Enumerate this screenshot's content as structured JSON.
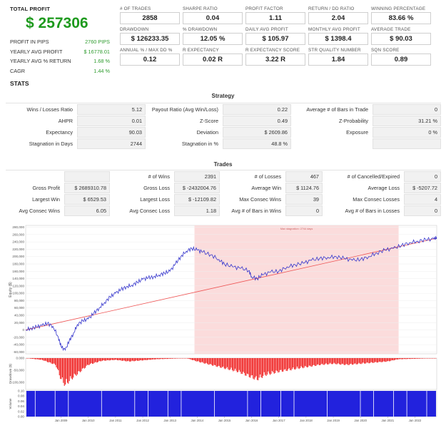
{
  "summary": {
    "total_profit_label": "TOTAL PROFIT",
    "total_profit_value": "$ 257306",
    "rows": [
      {
        "label": "PROFIT IN PIPS",
        "value": "2760 PIPS"
      },
      {
        "label": "YEARLY AVG PROFIT",
        "value": "$ 16778.01"
      },
      {
        "label": "YEARLY AVG % RETURN",
        "value": "1.68 %"
      },
      {
        "label": "CAGR",
        "value": "1.44 %"
      }
    ]
  },
  "stats_title": "STATS",
  "metrics": [
    {
      "label": "# OF TRADES",
      "value": "2858"
    },
    {
      "label": "SHARPE RATIO",
      "value": "0.04"
    },
    {
      "label": "PROFIT FACTOR",
      "value": "1.11"
    },
    {
      "label": "RETURN / DD RATIO",
      "value": "2.04"
    },
    {
      "label": "WINNING PERCENTAGE",
      "value": "83.66 %"
    },
    {
      "label": "DRAWDOWN",
      "value": "$ 126233.35"
    },
    {
      "label": "% DRAWDOWN",
      "value": "12.05 %"
    },
    {
      "label": "DAILY AVG PROFIT",
      "value": "$ 105.97"
    },
    {
      "label": "MONTHLY AVG PROFIT",
      "value": "$ 1398.4"
    },
    {
      "label": "AVERAGE TRADE",
      "value": "$ 90.03"
    },
    {
      "label": "ANNUAL % / MAX DD %",
      "value": "0.12"
    },
    {
      "label": "R EXPECTANCY",
      "value": "0.02 R"
    },
    {
      "label": "R EXPECTANCY SCORE",
      "value": "3.22 R"
    },
    {
      "label": "STR QUALITY NUMBER",
      "value": "1.84"
    },
    {
      "label": "SQN SCORE",
      "value": "0.89"
    }
  ],
  "strategy": {
    "title": "Strategy",
    "rows": [
      [
        {
          "label": "Wins / Losses Ratio",
          "value": "5.12"
        },
        {
          "label": "Payout Ratio (Avg Win/Loss)",
          "value": "0.22"
        },
        {
          "label": "Average # of Bars in Trade",
          "value": "0"
        }
      ],
      [
        {
          "label": "AHPR",
          "value": "0.01"
        },
        {
          "label": "Z-Score",
          "value": "0.49"
        },
        {
          "label": "Z-Probability",
          "value": "31.21 %"
        }
      ],
      [
        {
          "label": "Expectancy",
          "value": "90.03"
        },
        {
          "label": "Deviation",
          "value": "$ 2609.86"
        },
        {
          "label": "Exposure",
          "value": "0 %"
        }
      ],
      [
        {
          "label": "Stagnation in Days",
          "value": "2744"
        },
        {
          "label": "Stagnation in %",
          "value": "48.8 %"
        },
        {
          "label": "",
          "value": ""
        }
      ]
    ]
  },
  "trades": {
    "title": "Trades",
    "rows": [
      [
        {
          "label": "",
          "value": ""
        },
        {
          "label": "# of Wins",
          "value": "2391"
        },
        {
          "label": "# of Losses",
          "value": "467"
        },
        {
          "label": "# of Cancelled/Expired",
          "value": "0"
        }
      ],
      [
        {
          "label": "Gross Profit",
          "value": "$ 2689310.78"
        },
        {
          "label": "Gross Loss",
          "value": "$ -2432004.76"
        },
        {
          "label": "Average Win",
          "value": "$ 1124.76"
        },
        {
          "label": "Average Loss",
          "value": "$ -5207.72"
        }
      ],
      [
        {
          "label": "Largest Win",
          "value": "$ 6529.53"
        },
        {
          "label": "Largest Loss",
          "value": "$ -12109.82"
        },
        {
          "label": "Max Consec Wins",
          "value": "39"
        },
        {
          "label": "Max Consec Losses",
          "value": "4"
        }
      ],
      [
        {
          "label": "Avg Consec Wins",
          "value": "6.05"
        },
        {
          "label": "Avg Consec Loss",
          "value": "1.18"
        },
        {
          "label": "Avg # of Bars in Wins",
          "value": "0"
        },
        {
          "label": "Avg # of Bars in Losses",
          "value": "0"
        }
      ]
    ]
  },
  "chart_data": {
    "type": "line",
    "panels": [
      "equity",
      "drawdown",
      "volume"
    ],
    "stagnation_label": "Max stagnation: 2744 days",
    "equity_axis": {
      "label": "Equity ($)",
      "ticks": [
        "280,000",
        "260,000",
        "240,000",
        "220,000",
        "200,000",
        "180,000",
        "160,000",
        "140,000",
        "120,000",
        "100,000",
        "80,000",
        "60,000",
        "40,000",
        "20,000",
        "0",
        "-20,000",
        "-40,000",
        "-60,000"
      ],
      "ylim": [
        -65000,
        285000
      ]
    },
    "drawdown_axis": {
      "label": "Drawdown ($)",
      "ticks": [
        "0.000",
        "-50,000",
        "-100,000"
      ],
      "ylim": [
        -130000,
        0
      ]
    },
    "volume_axis": {
      "label": "Volume",
      "ticks": [
        "0.10",
        "0.08",
        "0.06",
        "0.04",
        "0.02",
        "0.00"
      ],
      "ylim": [
        0,
        0.1
      ]
    },
    "x_ticks": [
      "Jan 2009",
      "Jan 2010",
      "Jan 2011",
      "Jan 2012",
      "Jan 2013",
      "Jan 2014",
      "Jan 2015",
      "Jan 2016",
      "Jan 2017",
      "Jan 2018",
      "Jan 2019",
      "Jan 2020",
      "Jan 2021",
      "Jan 2022"
    ],
    "xlim": [
      2007.7,
      2022.8
    ],
    "stagnation_period": [
      2013.9,
      2021.4
    ],
    "trend_line": [
      [
        2007.7,
        0
      ],
      [
        2022.8,
        250000
      ]
    ],
    "equity_series": [
      [
        2007.7,
        0
      ],
      [
        2007.9,
        5000
      ],
      [
        2008.1,
        8000
      ],
      [
        2008.3,
        12000
      ],
      [
        2008.5,
        18000
      ],
      [
        2008.7,
        10000
      ],
      [
        2008.9,
        -20000
      ],
      [
        2009.0,
        -45000
      ],
      [
        2009.15,
        -55000
      ],
      [
        2009.3,
        -30000
      ],
      [
        2009.45,
        -10000
      ],
      [
        2009.6,
        15000
      ],
      [
        2009.8,
        25000
      ],
      [
        2010.0,
        30000
      ],
      [
        2010.2,
        45000
      ],
      [
        2010.4,
        60000
      ],
      [
        2010.6,
        75000
      ],
      [
        2010.8,
        90000
      ],
      [
        2011.0,
        100000
      ],
      [
        2011.2,
        110000
      ],
      [
        2011.4,
        118000
      ],
      [
        2011.6,
        122000
      ],
      [
        2011.8,
        130000
      ],
      [
        2012.0,
        138000
      ],
      [
        2012.2,
        142000
      ],
      [
        2012.4,
        145000
      ],
      [
        2012.6,
        150000
      ],
      [
        2012.8,
        155000
      ],
      [
        2013.0,
        160000
      ],
      [
        2013.2,
        180000
      ],
      [
        2013.4,
        200000
      ],
      [
        2013.6,
        215000
      ],
      [
        2013.8,
        222000
      ],
      [
        2014.0,
        218000
      ],
      [
        2014.2,
        212000
      ],
      [
        2014.5,
        205000
      ],
      [
        2014.8,
        192000
      ],
      [
        2015.0,
        180000
      ],
      [
        2015.3,
        172000
      ],
      [
        2015.6,
        168000
      ],
      [
        2015.9,
        162000
      ],
      [
        2016.0,
        145000
      ],
      [
        2016.2,
        140000
      ],
      [
        2016.4,
        150000
      ],
      [
        2016.7,
        158000
      ],
      [
        2017.0,
        160000
      ],
      [
        2017.3,
        172000
      ],
      [
        2017.6,
        178000
      ],
      [
        2017.9,
        182000
      ],
      [
        2018.2,
        190000
      ],
      [
        2018.5,
        195000
      ],
      [
        2018.8,
        198000
      ],
      [
        2019.1,
        200000
      ],
      [
        2019.4,
        195000
      ],
      [
        2019.7,
        190000
      ],
      [
        2020.0,
        192000
      ],
      [
        2020.3,
        200000
      ],
      [
        2020.6,
        210000
      ],
      [
        2020.9,
        218000
      ],
      [
        2021.2,
        222000
      ],
      [
        2021.5,
        230000
      ],
      [
        2021.8,
        238000
      ],
      [
        2022.1,
        242000
      ],
      [
        2022.4,
        246000
      ],
      [
        2022.7,
        248000
      ],
      [
        2022.8,
        252000
      ]
    ],
    "drawdown_series": [
      [
        2007.7,
        0
      ],
      [
        2008.3,
        -8000
      ],
      [
        2008.8,
        -30000
      ],
      [
        2009.0,
        -95000
      ],
      [
        2009.15,
        -120000
      ],
      [
        2009.4,
        -90000
      ],
      [
        2009.7,
        -60000
      ],
      [
        2010.0,
        -30000
      ],
      [
        2010.5,
        -12000
      ],
      [
        2011.0,
        -8000
      ],
      [
        2011.5,
        -15000
      ],
      [
        2012.0,
        -10000
      ],
      [
        2012.5,
        -5000
      ],
      [
        2013.0,
        -3000
      ],
      [
        2013.6,
        0
      ],
      [
        2014.0,
        -15000
      ],
      [
        2014.5,
        -30000
      ],
      [
        2015.0,
        -45000
      ],
      [
        2015.5,
        -60000
      ],
      [
        2016.0,
        -85000
      ],
      [
        2016.2,
        -95000
      ],
      [
        2016.5,
        -75000
      ],
      [
        2017.0,
        -60000
      ],
      [
        2017.5,
        -50000
      ],
      [
        2018.0,
        -40000
      ],
      [
        2018.5,
        -30000
      ],
      [
        2019.0,
        -25000
      ],
      [
        2019.5,
        -30000
      ],
      [
        2020.0,
        -25000
      ],
      [
        2020.5,
        -20000
      ],
      [
        2021.0,
        -15000
      ],
      [
        2021.4,
        -5000
      ],
      [
        2022.0,
        -3000
      ],
      [
        2022.8,
        0
      ]
    ]
  }
}
